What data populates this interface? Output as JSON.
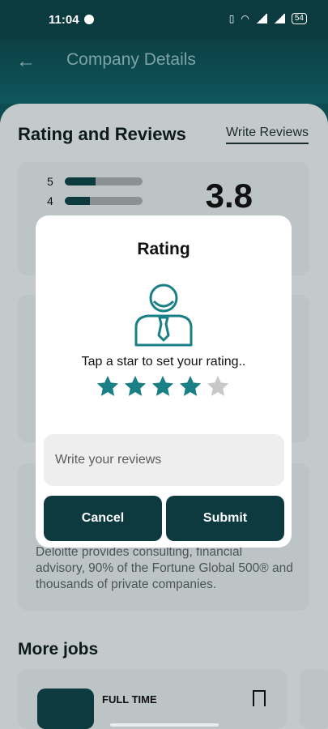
{
  "status_bar": {
    "time": "11:04",
    "battery": "54"
  },
  "app_bar": {
    "title": "Company Details"
  },
  "section": {
    "title": "Rating and Reviews",
    "write_link": "Write Reviews"
  },
  "rating_summary": {
    "score": "3.8",
    "bars": [
      {
        "label": "5",
        "fill": 0.4
      },
      {
        "label": "4",
        "fill": 0.32
      }
    ]
  },
  "about": {
    "text": "Deloitte provides consulting, financial advisory, 90% of the Fortune Global 500® and thousands of private companies."
  },
  "more_jobs": {
    "title": "More jobs",
    "job_type": "FULL TIME"
  },
  "dialog": {
    "title": "Rating",
    "prompt": "Tap a star to set your rating..",
    "stars_total": 5,
    "stars_selected": 4,
    "star_color": "#1b7f86",
    "star_empty_color": "#c8c8c8",
    "review_placeholder": "Write your reviews",
    "cancel_label": "Cancel",
    "submit_label": "Submit"
  },
  "colors": {
    "accent": "#0c3a3f",
    "scrim": "#c4cacb"
  }
}
